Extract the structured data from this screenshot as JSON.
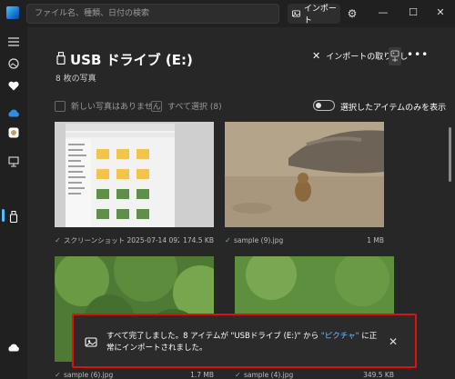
{
  "search": {
    "placeholder": "ファイル名、種類、日付の検索"
  },
  "titlebar": {
    "import_label": "インポート",
    "icons": [
      "app-logo",
      "import-icon",
      "gear-icon",
      "minimize-icon",
      "maximize-icon",
      "close-icon"
    ]
  },
  "rail": {
    "items": [
      "menu-icon",
      "gallery-icon",
      "favorites-icon",
      "onedrive-icon",
      "icloud-icon",
      "computer-icon",
      "usb-drive-icon",
      "cloud-icon"
    ]
  },
  "header": {
    "title": "USB ドライブ (E:)",
    "count": "8 枚の写真",
    "cancel_import": "インポートの取り消し",
    "more": "•••"
  },
  "filters": {
    "no_new": "新しい写真はありません",
    "select_all": "すべて選択 (8)",
    "only_selected": "選択したアイテムのみを表示"
  },
  "photos": [
    {
      "name": "スクリーンショット 2025-07-14 092408...",
      "size": "174.5 KB"
    },
    {
      "name": "sample (9).jpg",
      "size": "1 MB"
    },
    {
      "name": "sample (6).jpg",
      "size": "1.7 MB"
    },
    {
      "name": "sample (4).jpg",
      "size": "349.5 KB"
    }
  ],
  "notification": {
    "text_1": "すべて完了しました。8 アイテムが \"USBドライブ (E:)\" から ",
    "link": "\"ピクチャ\"",
    "text_2": " に正常にインポートされました。"
  },
  "colors": {
    "accent": "#4cc2ff",
    "highlight_border": "#e01010",
    "link": "#6ec1ff"
  }
}
